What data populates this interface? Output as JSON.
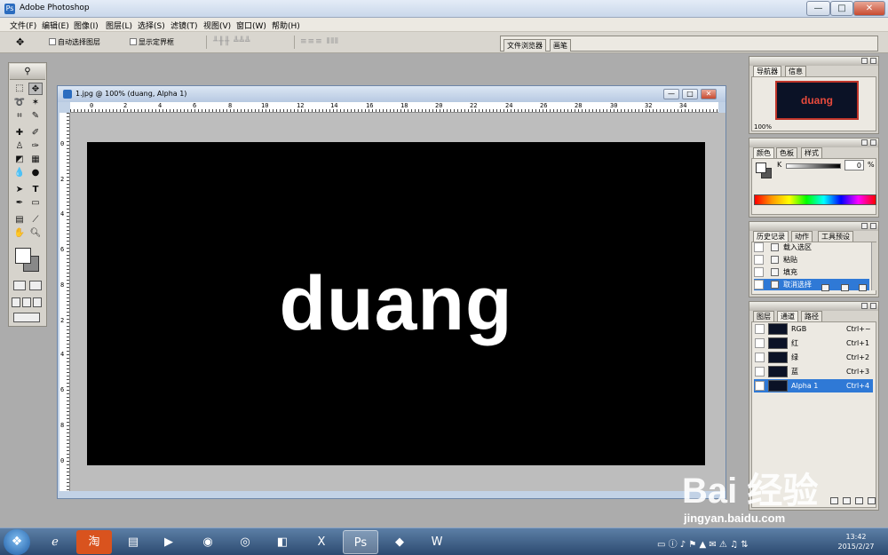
{
  "app": {
    "title": "Adobe Photoshop",
    "icon": "photoshop-icon"
  },
  "window_controls": {
    "minimize": "—",
    "maximize": "□",
    "close": "✕"
  },
  "menu": [
    "文件(F)",
    "编辑(E)",
    "图像(I)",
    "图层(L)",
    "选择(S)",
    "滤镜(T)",
    "视图(V)",
    "窗口(W)",
    "帮助(H)"
  ],
  "options": {
    "tool_glyph": "✥",
    "auto_select_label": "自动选择图层",
    "show_bounds_label": "显示定界框",
    "align_group": "╨╫╫ ╩╩╩",
    "distribute_group": "≡≡≡ ⫴⫴⫴",
    "well_tabs": [
      "文件浏览器",
      "画笔"
    ]
  },
  "document": {
    "title": "1.jpg @ 100% (duang, Alpha 1)",
    "ruler_h": [
      "0",
      "2",
      "4",
      "6",
      "8",
      "10",
      "12",
      "14",
      "16",
      "18",
      "20",
      "22",
      "24",
      "26",
      "28",
      "30",
      "32",
      "34"
    ],
    "ruler_v": [
      "0",
      "2",
      "4",
      "6",
      "8",
      "2",
      "4",
      "6",
      "8",
      "0"
    ],
    "canvas_text": "duang"
  },
  "navigator": {
    "tabs": [
      "导航器",
      "信息"
    ],
    "thumb_text": "duang",
    "zoom": "100%"
  },
  "color_panel": {
    "tabs": [
      "颜色",
      "色板",
      "样式"
    ],
    "channel_label": "K",
    "value": "0",
    "unit": "%"
  },
  "history": {
    "tabs": [
      "历史记录",
      "动作",
      "工具预设"
    ],
    "items": [
      {
        "label": "载入选区",
        "selected": false
      },
      {
        "label": "粘贴",
        "selected": false
      },
      {
        "label": "填充",
        "selected": false
      },
      {
        "label": "取消选择",
        "selected": true
      }
    ]
  },
  "layers": {
    "tabs": [
      "图层",
      "通道",
      "路径"
    ],
    "channels": [
      {
        "name": "RGB",
        "shortcut": "Ctrl+~",
        "selected": false
      },
      {
        "name": "红",
        "shortcut": "Ctrl+1",
        "selected": false
      },
      {
        "name": "绿",
        "shortcut": "Ctrl+2",
        "selected": false
      },
      {
        "name": "蓝",
        "shortcut": "Ctrl+3",
        "selected": false
      },
      {
        "name": "Alpha 1",
        "shortcut": "Ctrl+4",
        "selected": true
      }
    ]
  },
  "watermark": {
    "brand": "Bai 经验",
    "url": "jingyan.baidu.com"
  },
  "taskbar": {
    "apps": [
      "ie-icon",
      "taobao-icon",
      "folder-icon",
      "media-player-icon",
      "360-icon",
      "chrome-icon",
      "app-icon",
      "excel-icon",
      "photoshop-icon",
      "browser-icon",
      "word-icon"
    ],
    "clock_time": "13:42",
    "clock_date": "2015/2/27"
  },
  "colors": {
    "selection_blue": "#2f79d6",
    "canvas": "#000000",
    "workspace": "#acacac"
  }
}
